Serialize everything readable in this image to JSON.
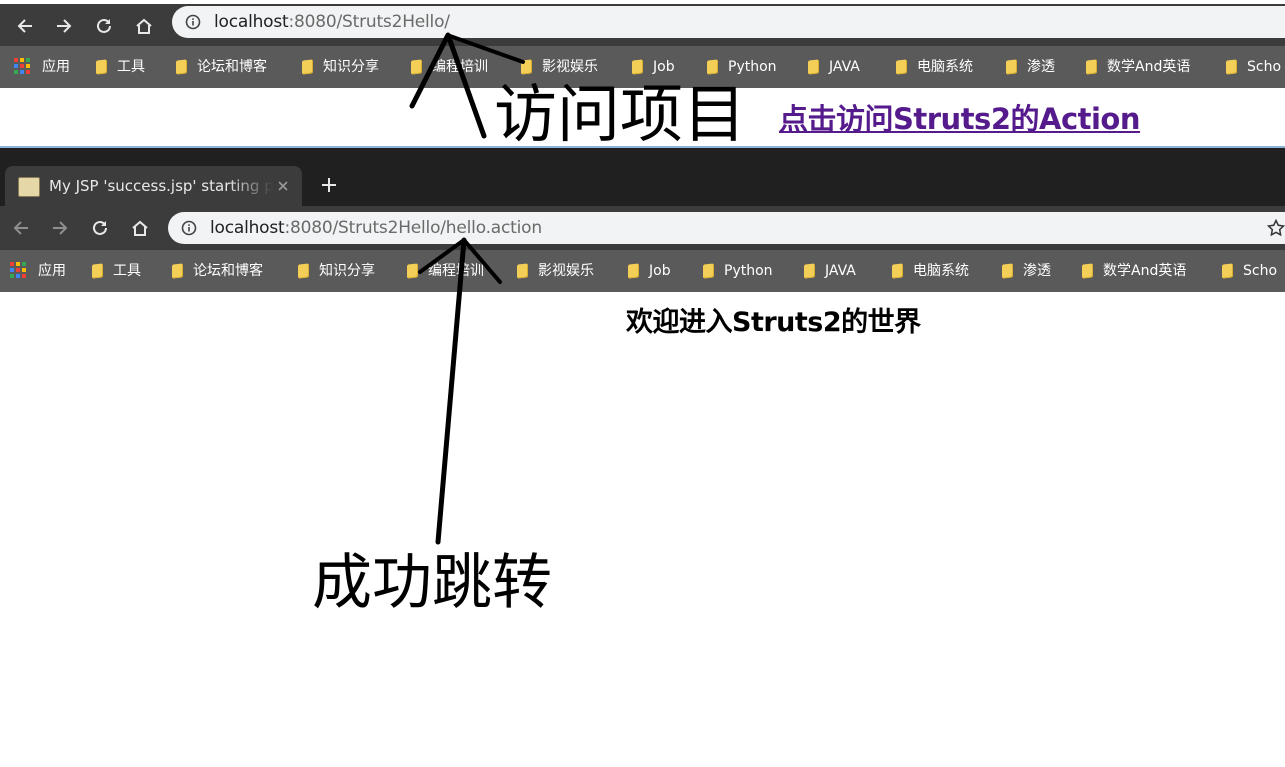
{
  "top_browser": {
    "url_host": "localhost",
    "url_rest": ":8080/Struts2Hello/",
    "page_link": "点击访问Struts2的Action"
  },
  "bottom_browser": {
    "tab_title": "My JSP 'success.jsp' starting page",
    "url_host": "localhost",
    "url_rest": ":8080/Struts2Hello/hello.action",
    "page_heading": "欢迎进入Struts2的世界"
  },
  "bookmarks": [
    {
      "label": "应用",
      "icon": "apps-grid-icon"
    },
    {
      "label": "工具",
      "icon": "folder-icon"
    },
    {
      "label": "论坛和博客",
      "icon": "folder-icon"
    },
    {
      "label": "知识分享",
      "icon": "folder-icon"
    },
    {
      "label": "编程培训",
      "icon": "folder-icon"
    },
    {
      "label": "影视娱乐",
      "icon": "folder-icon"
    },
    {
      "label": "Job",
      "icon": "folder-icon"
    },
    {
      "label": "Python",
      "icon": "folder-icon"
    },
    {
      "label": "JAVA",
      "icon": "folder-icon"
    },
    {
      "label": "电脑系统",
      "icon": "folder-icon"
    },
    {
      "label": "渗透",
      "icon": "folder-icon"
    },
    {
      "label": "数学And英语",
      "icon": "folder-icon"
    },
    {
      "label": "Scho",
      "icon": "folder-icon"
    }
  ],
  "annotations": {
    "visit_project": "访问项目",
    "success_redirect": "成功跳转"
  },
  "colors": {
    "toolbar": "#3c3c3c",
    "bookmarks_bar": "#5a5a5a",
    "tabstrip": "#202020",
    "omnibox": "#f1f3f4",
    "visited_link": "#551a8b",
    "folder": "#f4cf57"
  }
}
